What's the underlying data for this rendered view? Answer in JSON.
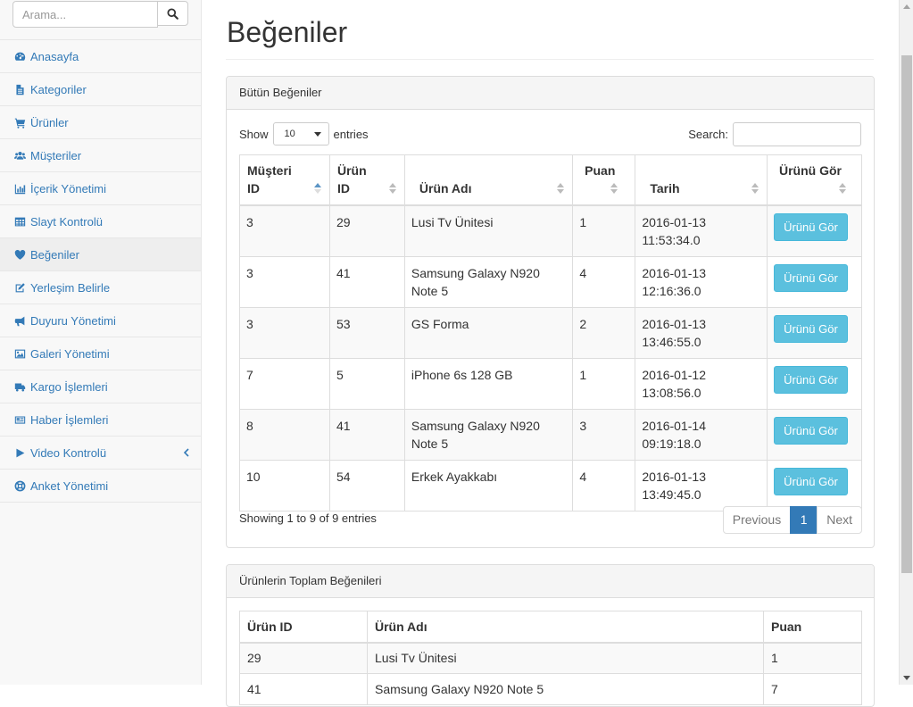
{
  "search": {
    "placeholder": "Arama..."
  },
  "sidebar": {
    "items": [
      {
        "label": "Anasayfa",
        "icon": "dashboard-icon"
      },
      {
        "label": "Kategoriler",
        "icon": "file-icon"
      },
      {
        "label": "Ürünler",
        "icon": "cart-icon"
      },
      {
        "label": "Müşteriler",
        "icon": "users-icon"
      },
      {
        "label": "İçerik Yönetimi",
        "icon": "bar-chart-icon"
      },
      {
        "label": "Slayt Kontrolü",
        "icon": "table-icon"
      },
      {
        "label": "Beğeniler",
        "icon": "heart-icon",
        "active": true
      },
      {
        "label": "Yerleşim Belirle",
        "icon": "edit-icon"
      },
      {
        "label": "Duyuru Yönetimi",
        "icon": "bullhorn-icon"
      },
      {
        "label": "Galeri Yönetimi",
        "icon": "image-icon"
      },
      {
        "label": "Kargo İşlemleri",
        "icon": "truck-icon"
      },
      {
        "label": "Haber İşlemleri",
        "icon": "newspaper-icon"
      },
      {
        "label": "Video Kontrolü",
        "icon": "play-icon",
        "has_submenu": true
      },
      {
        "label": "Anket Yönetimi",
        "icon": "life-ring-icon"
      }
    ]
  },
  "page": {
    "title": "Beğeniler"
  },
  "likes_panel": {
    "heading": "Bütün Beğeniler",
    "show_label": "Show",
    "entries_value": "10",
    "entries_label": "entries",
    "search_label": "Search:",
    "columns": [
      "Müşteri ID",
      "Ürün ID",
      "Ürün Adı",
      "Puan",
      "Tarih",
      "Ürünü Gör"
    ],
    "rows": [
      {
        "customer_id": "3",
        "product_id": "29",
        "product_name": "Lusi Tv Ünitesi",
        "score": "1",
        "date": "2016-01-13 11:53:34.0",
        "button": "Ürünü Gör"
      },
      {
        "customer_id": "3",
        "product_id": "41",
        "product_name": "Samsung Galaxy N920 Note 5",
        "score": "4",
        "date": "2016-01-13 12:16:36.0",
        "button": "Ürünü Gör"
      },
      {
        "customer_id": "3",
        "product_id": "53",
        "product_name": "GS Forma",
        "score": "2",
        "date": "2016-01-13 13:46:55.0",
        "button": "Ürünü Gör"
      },
      {
        "customer_id": "7",
        "product_id": "5",
        "product_name": "iPhone 6s 128 GB",
        "score": "1",
        "date": "2016-01-12 13:08:56.0",
        "button": "Ürünü Gör"
      },
      {
        "customer_id": "8",
        "product_id": "41",
        "product_name": "Samsung Galaxy N920 Note 5",
        "score": "3",
        "date": "2016-01-14 09:19:18.0",
        "button": "Ürünü Gör"
      },
      {
        "customer_id": "10",
        "product_id": "54",
        "product_name": "Erkek Ayakkabı",
        "score": "4",
        "date": "2016-01-13 13:49:45.0",
        "button": "Ürünü Gör"
      }
    ],
    "info": "Showing 1 to 9 of 9 entries",
    "pagination": {
      "previous": "Previous",
      "current": "1",
      "next": "Next"
    }
  },
  "totals_panel": {
    "heading": "Ürünlerin Toplam Beğenileri",
    "columns": [
      "Ürün ID",
      "Ürün Adı",
      "Puan"
    ],
    "rows": [
      {
        "product_id": "29",
        "product_name": "Lusi Tv Ünitesi",
        "score": "1"
      },
      {
        "product_id": "41",
        "product_name": "Samsung Galaxy N920 Note 5",
        "score": "7"
      }
    ]
  },
  "colors": {
    "link": "#337ab7",
    "info_button": "#5bc0de",
    "sidebar_bg": "#f8f8f8"
  }
}
